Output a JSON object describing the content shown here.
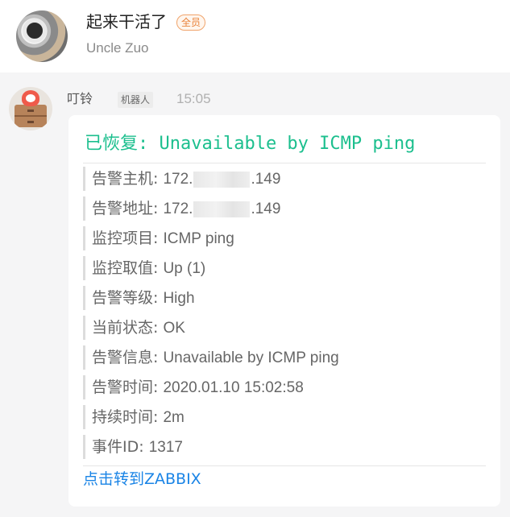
{
  "profile": {
    "name": "起来干活了",
    "badge": "全员",
    "subtitle": "Uncle Zuo"
  },
  "message": {
    "sender": "叮铃",
    "robot_tag": "机器人",
    "time": "15:05"
  },
  "card": {
    "title": "已恢复: Unavailable by ICMP ping",
    "rows": [
      {
        "label": "告警主机: ",
        "prefix": "172.",
        "suffix": ".149"
      },
      {
        "label": "告警地址: ",
        "prefix": "172.",
        "suffix": ".149"
      },
      {
        "label": "监控项目: ",
        "value": "ICMP ping"
      },
      {
        "label": "监控取值: ",
        "value": "Up (1)"
      },
      {
        "label": "告警等级: ",
        "value": "High"
      },
      {
        "label": "当前状态: ",
        "value": "OK"
      },
      {
        "label": "告警信息: ",
        "value": "Unavailable by ICMP ping"
      },
      {
        "label": "告警时间: ",
        "value": "2020.01.10 15:02:58"
      },
      {
        "label": "持续时间: ",
        "value": "2m"
      },
      {
        "label": "事件ID: ",
        "value": "1317"
      }
    ],
    "link": "点击转到ZABBIX"
  },
  "colors": {
    "title_green": "#1cbf8e",
    "link_blue": "#1a84e6",
    "badge_orange": "#e8823a"
  }
}
